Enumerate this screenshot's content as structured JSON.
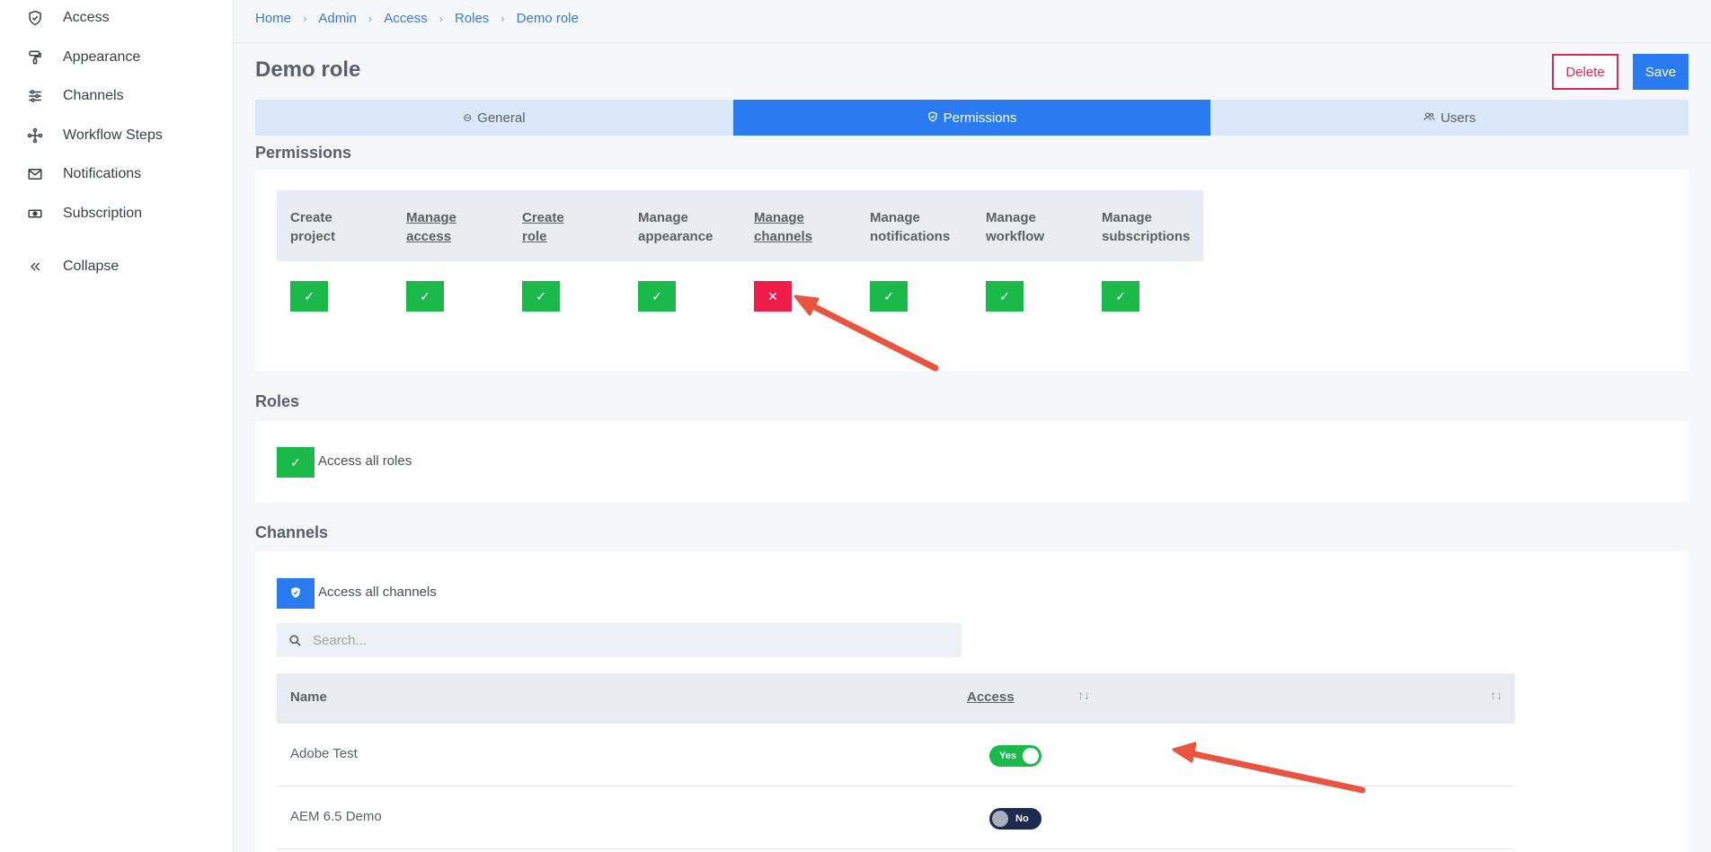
{
  "sidebar": {
    "items": [
      {
        "label": "Access",
        "icon": "shield-check-icon"
      },
      {
        "label": "Appearance",
        "icon": "paint-roller-icon"
      },
      {
        "label": "Channels",
        "icon": "sliders-icon"
      },
      {
        "label": "Workflow Steps",
        "icon": "workflow-icon"
      },
      {
        "label": "Notifications",
        "icon": "envelope-icon"
      },
      {
        "label": "Subscription",
        "icon": "money-icon"
      }
    ],
    "collapse_label": "Collapse"
  },
  "breadcrumb": [
    "Home",
    "Admin",
    "Access",
    "Roles",
    "Demo role"
  ],
  "page": {
    "title": "Demo role",
    "delete_label": "Delete",
    "save_label": "Save"
  },
  "tabs": [
    {
      "label": "General",
      "active": false
    },
    {
      "label": "Permissions",
      "active": true
    },
    {
      "label": "Users",
      "active": false
    }
  ],
  "permissions": {
    "heading": "Permissions",
    "columns": [
      {
        "line1": "Create",
        "line2": "project",
        "granted": true,
        "sortable": false
      },
      {
        "line1": "Manage",
        "line2": "access",
        "granted": true,
        "sortable": true
      },
      {
        "line1": "Create",
        "line2": "role",
        "granted": true,
        "sortable": true
      },
      {
        "line1": "Manage",
        "line2": "appearance",
        "granted": true,
        "sortable": false
      },
      {
        "line1": "Manage",
        "line2": "channels",
        "granted": false,
        "sortable": true
      },
      {
        "line1": "Manage",
        "line2": "notifications",
        "granted": true,
        "sortable": false
      },
      {
        "line1": "Manage",
        "line2": "workflow",
        "granted": true,
        "sortable": false
      },
      {
        "line1": "Manage",
        "line2": "subscriptions",
        "granted": true,
        "sortable": false
      }
    ]
  },
  "roles": {
    "heading": "Roles",
    "access_all_label": "Access all roles",
    "access_all": true
  },
  "channels": {
    "heading": "Channels",
    "access_all_label": "Access all channels",
    "search_placeholder": "Search...",
    "col_name": "Name",
    "col_access": "Access",
    "rows": [
      {
        "name": "Adobe Test",
        "access": true,
        "toggle_label": "Yes"
      },
      {
        "name": "AEM 6.5 Demo",
        "access": false,
        "toggle_label": "No"
      }
    ]
  },
  "colors": {
    "accent": "#2a7bf0",
    "granted": "#1ab94a",
    "denied": "#ee1c48",
    "annotation_arrow": "#e8543f"
  }
}
